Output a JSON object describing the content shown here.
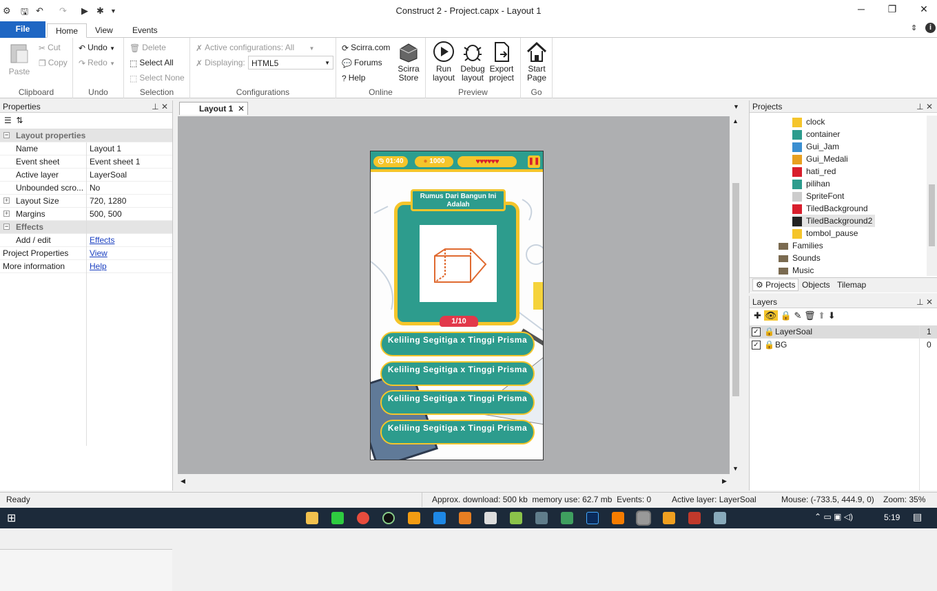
{
  "window": {
    "title": "Construct 2 - Project.capx - Layout 1"
  },
  "ribbon_tabs": [
    "File",
    "Home",
    "View",
    "Events"
  ],
  "ribbon": {
    "clipboard": {
      "paste": "Paste",
      "cut": "Cut",
      "copy": "Copy",
      "group": "Clipboard"
    },
    "undo": {
      "undo": "Undo",
      "redo": "Redo",
      "group": "Undo"
    },
    "selection": {
      "delete": "Delete",
      "select_all": "Select All",
      "select_none": "Select None",
      "group": "Selection"
    },
    "configurations": {
      "active": "Active configurations: All",
      "displaying_label": "Displaying:",
      "displaying_value": "HTML5",
      "group": "Configurations"
    },
    "online": {
      "scirra": "Scirra.com",
      "forums": "Forums",
      "help": "Help",
      "store_line1": "Scirra",
      "store_line2": "Store",
      "group": "Online"
    },
    "preview": {
      "run1": "Run",
      "run2": "layout",
      "debug1": "Debug",
      "debug2": "layout",
      "export1": "Export",
      "export2": "project",
      "group": "Preview"
    },
    "go": {
      "start1": "Start",
      "start2": "Page",
      "group": "Go"
    }
  },
  "properties": {
    "title": "Properties",
    "cat_layout": "Layout properties",
    "rows": [
      {
        "k": "Name",
        "v": "Layout 1"
      },
      {
        "k": "Event sheet",
        "v": "Event sheet 1"
      },
      {
        "k": "Active layer",
        "v": "LayerSoal"
      },
      {
        "k": "Unbounded scro...",
        "v": "No"
      },
      {
        "k": "Layout Size",
        "v": "720, 1280"
      },
      {
        "k": "Margins",
        "v": "500, 500"
      }
    ],
    "cat_effects": "Effects",
    "effects_k": "Add / edit",
    "effects_v": "Effects",
    "projprops_k": "Project Properties",
    "projprops_v": "View",
    "moreinfo_k": "More information",
    "moreinfo_v": "Help"
  },
  "editor": {
    "tab": "Layout 1"
  },
  "game": {
    "time": "01:40",
    "score": "1000",
    "question_title": "Rumus Dari Bangun Ini Adalah",
    "counter": "1/10",
    "answers": [
      "Keliling Segitiga x Tinggi Prisma",
      "Keliling Segitiga x Tinggi Prisma",
      "Keliling Segitiga x Tinggi Prisma",
      "Keliling Segitiga x Tinggi Prisma"
    ]
  },
  "projects": {
    "title": "Projects",
    "objects": [
      {
        "name": "clock",
        "color": "#f5c52b"
      },
      {
        "name": "container",
        "color": "#2d9c8d"
      },
      {
        "name": "Gui_Jam",
        "color": "#3b8fd1"
      },
      {
        "name": "Gui_Medali",
        "color": "#e8a020"
      },
      {
        "name": "hati_red",
        "color": "#d81e2c"
      },
      {
        "name": "pilihan",
        "color": "#2d9c8d"
      },
      {
        "name": "SpriteFont",
        "color": "#cccccc"
      },
      {
        "name": "TiledBackground",
        "color": "#d81e2c"
      },
      {
        "name": "TiledBackground2",
        "color": "#222222"
      },
      {
        "name": "tombol_pause",
        "color": "#f5c52b"
      }
    ],
    "folders": [
      "Families",
      "Sounds",
      "Music"
    ],
    "tabs": [
      "Projects",
      "Objects",
      "Tilemap"
    ]
  },
  "layers": {
    "title": "Layers",
    "rows": [
      {
        "name": "LayerSoal",
        "num": "1"
      },
      {
        "name": "BG",
        "num": "0"
      }
    ]
  },
  "status": {
    "ready": "Ready",
    "download": "Approx. download: 500 kb  memory use: 62.7 mb  Events: 0",
    "active_layer": "Active layer: LayerSoal",
    "mouse": "Mouse: (-733.5, 444.9, 0)",
    "zoom": "Zoom: 35%"
  },
  "taskbar": {
    "time": "5:19"
  }
}
